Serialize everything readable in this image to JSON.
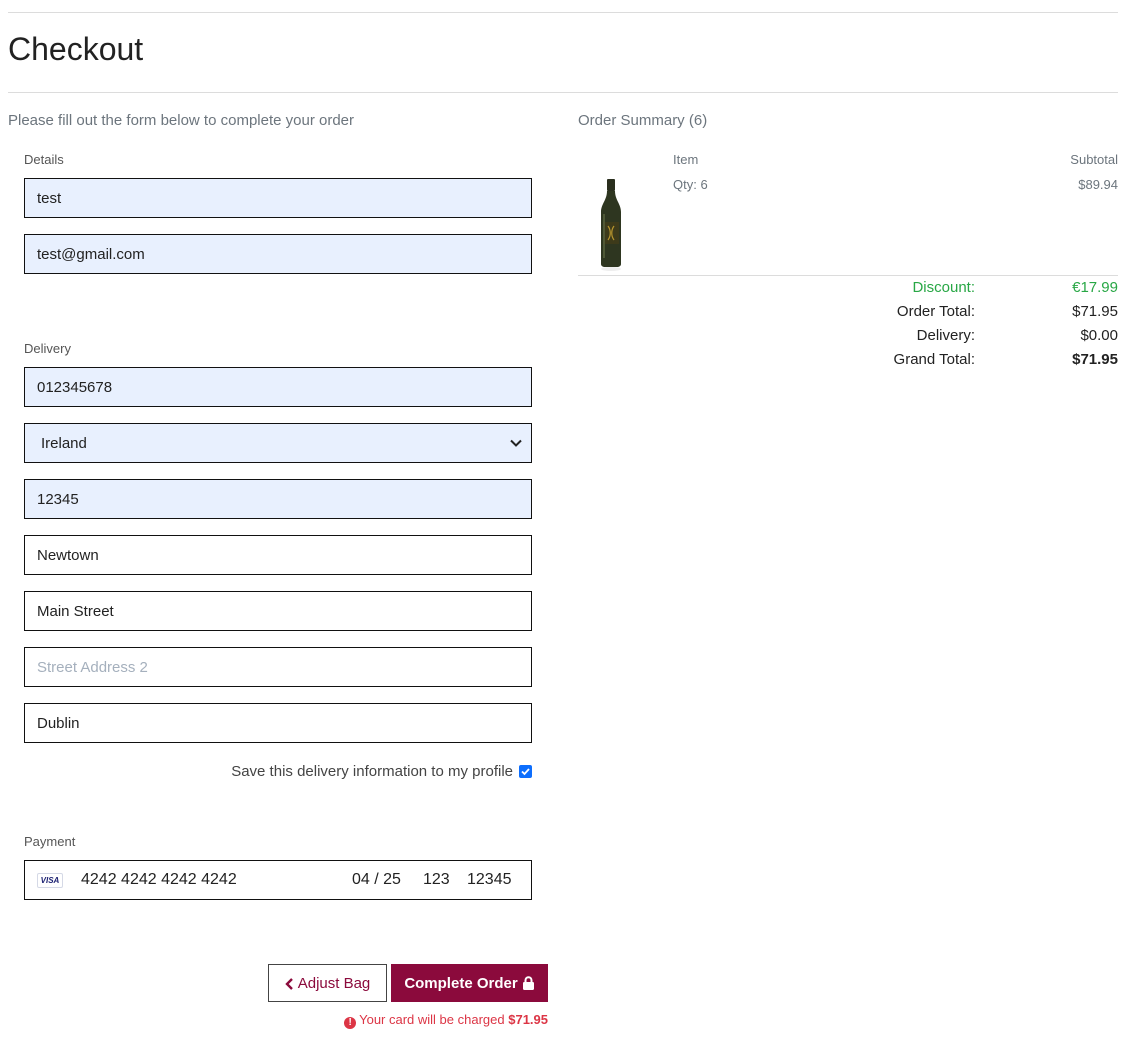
{
  "page": {
    "title": "Checkout",
    "intro": "Please fill out the form below to complete your order"
  },
  "details": {
    "label": "Details",
    "full_name": "test",
    "email": "test@gmail.com"
  },
  "delivery": {
    "label": "Delivery",
    "phone": "012345678",
    "country": "Ireland",
    "postcode": "12345",
    "town": "Newtown",
    "street1": "Main Street",
    "street2_placeholder": "Street Address 2",
    "county": "Dublin",
    "save_label": "Save this delivery information to my profile",
    "save_checked": true
  },
  "payment": {
    "label": "Payment",
    "card_brand": "VISA",
    "card_number": "4242 4242 4242 4242",
    "expiry": "04 / 25",
    "cvc": "123",
    "postal": "12345"
  },
  "actions": {
    "adjust_label": "Adjust Bag",
    "complete_label": "Complete Order",
    "charge_text": "Your card will be charged",
    "charge_amount": "$71.95"
  },
  "summary": {
    "title": "Order Summary (6)",
    "col_item": "Item",
    "col_subtotal": "Subtotal",
    "qty": "Qty: 6",
    "line_subtotal": "$89.94",
    "discount_label": "Discount:",
    "discount_value": "€17.99",
    "order_total_label": "Order Total:",
    "order_total_value": "$71.95",
    "delivery_label": "Delivery:",
    "delivery_value": "$0.00",
    "grand_total_label": "Grand Total:",
    "grand_total_value": "$71.95"
  },
  "colors": {
    "brand": "#8b0a3c",
    "autofill": "#e8f0fe",
    "discount": "#28a745",
    "warning": "#dc3545"
  }
}
